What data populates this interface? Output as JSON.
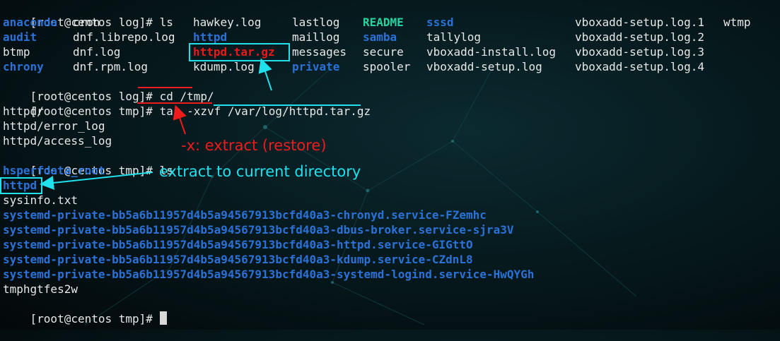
{
  "prompt": "[root@centos log]# ",
  "prompt_tmp": "[root@centos tmp]# ",
  "ls_cmd": "ls",
  "ls_output": {
    "col1": [
      {
        "text": "anaconda",
        "type": "dir"
      },
      {
        "text": "audit",
        "type": "dir"
      },
      {
        "text": "btmp",
        "type": "plain"
      },
      {
        "text": "chrony",
        "type": "dir"
      }
    ],
    "col2": [
      {
        "text": "cron",
        "type": "plain"
      },
      {
        "text": "dnf.librepo.log",
        "type": "plain"
      },
      {
        "text": "dnf.log",
        "type": "plain"
      },
      {
        "text": "dnf.rpm.log",
        "type": "plain"
      }
    ],
    "col3": [
      {
        "text": "hawkey.log",
        "type": "plain"
      },
      {
        "text": "httpd",
        "type": "dir"
      },
      {
        "text": "httpd.tar.gz",
        "type": "arc"
      },
      {
        "text": "kdump.log",
        "type": "plain"
      }
    ],
    "col4": [
      {
        "text": "lastlog",
        "type": "plain"
      },
      {
        "text": "maillog",
        "type": "plain"
      },
      {
        "text": "messages",
        "type": "plain"
      },
      {
        "text": "private",
        "type": "dir"
      }
    ],
    "col5": [
      {
        "text": "README",
        "type": "exe"
      },
      {
        "text": "samba",
        "type": "dir"
      },
      {
        "text": "secure",
        "type": "plain"
      },
      {
        "text": "spooler",
        "type": "plain"
      }
    ],
    "col6": [
      {
        "text": "sssd",
        "type": "dir"
      },
      {
        "text": "tallylog",
        "type": "plain"
      },
      {
        "text": "vboxadd-install.log",
        "type": "plain"
      },
      {
        "text": "vboxadd-setup.log",
        "type": "plain"
      }
    ],
    "col7": [
      {
        "text": "vboxadd-setup.log.1",
        "type": "plain"
      },
      {
        "text": "vboxadd-setup.log.2",
        "type": "plain"
      },
      {
        "text": "vboxadd-setup.log.3",
        "type": "plain"
      },
      {
        "text": "vboxadd-setup.log.4",
        "type": "plain"
      }
    ],
    "col8": [
      {
        "text": "wtmp",
        "type": "plain"
      }
    ]
  },
  "cd_cmd": "cd /tmp/",
  "tar_cmd": "tar -xzvf /var/log/httpd.tar.gz",
  "tar_output": [
    "httpd/",
    "httpd/error_log",
    "httpd/access_log"
  ],
  "ls_cmd2": "ls",
  "tmp_listing": [
    {
      "text": "hsperfdata_root",
      "type": "dir"
    },
    {
      "text": "httpd",
      "type": "dir"
    },
    {
      "text": "sysinfo.txt",
      "type": "plain"
    },
    {
      "text": "systemd-private-bb5a6b11957d4b5a94567913bcfd40a3-chronyd.service-FZemhc",
      "type": "dir"
    },
    {
      "text": "systemd-private-bb5a6b11957d4b5a94567913bcfd40a3-dbus-broker.service-sjra3V",
      "type": "dir"
    },
    {
      "text": "systemd-private-bb5a6b11957d4b5a94567913bcfd40a3-httpd.service-GIGttO",
      "type": "dir"
    },
    {
      "text": "systemd-private-bb5a6b11957d4b5a94567913bcfd40a3-kdump.service-CZdnL8",
      "type": "dir"
    },
    {
      "text": "systemd-private-bb5a6b11957d4b5a94567913bcfd40a3-systemd-logind.service-HwQYGh",
      "type": "dir"
    },
    {
      "text": "tmphgtfes2w",
      "type": "plain"
    }
  ],
  "annotations": {
    "extract_note": "-x: extract (restore)",
    "current_dir_note": "extract to current directory"
  },
  "colors": {
    "directory": "#2a72d8",
    "archive": "#e81a1a",
    "executable": "#2ad2a0",
    "annotation_red": "#ee1c1c",
    "annotation_cyan": "#20e0ee"
  }
}
